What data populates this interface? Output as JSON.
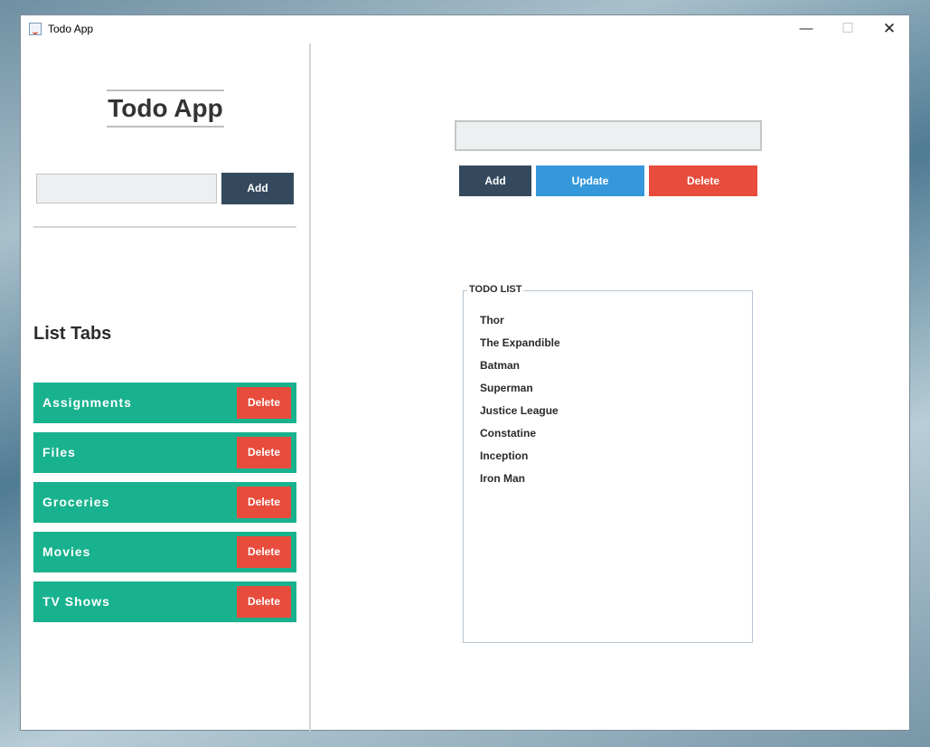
{
  "window": {
    "title": "Todo App",
    "controls": {
      "minimize": "—",
      "maximize": "☐",
      "close": "✕"
    }
  },
  "sidebar": {
    "app_title": "Todo App",
    "input_value": "",
    "add_label": "Add",
    "list_tabs_heading": "List Tabs",
    "tabs": [
      {
        "label": "Assignments",
        "delete_label": "Delete"
      },
      {
        "label": "Files",
        "delete_label": "Delete"
      },
      {
        "label": "Groceries",
        "delete_label": "Delete"
      },
      {
        "label": "Movies",
        "delete_label": "Delete"
      },
      {
        "label": "TV Shows",
        "delete_label": "Delete"
      }
    ]
  },
  "main": {
    "input_value": "",
    "add_label": "Add",
    "update_label": "Update",
    "delete_label": "Delete",
    "todo_list": {
      "title": "TODO LIST",
      "items": [
        "Thor",
        "The Expandible",
        "Batman",
        "Superman",
        "Justice League",
        "Constatine",
        "Inception",
        "Iron Man"
      ]
    }
  },
  "colors": {
    "dark_button": "#34495e",
    "update_button": "#3498db",
    "delete_button": "#e74c3c",
    "tab_background": "#19b28e"
  },
  "icons": {
    "app_icon": "java-cup-icon",
    "minimize": "minimize-icon",
    "maximize": "maximize-icon",
    "close": "close-icon"
  }
}
